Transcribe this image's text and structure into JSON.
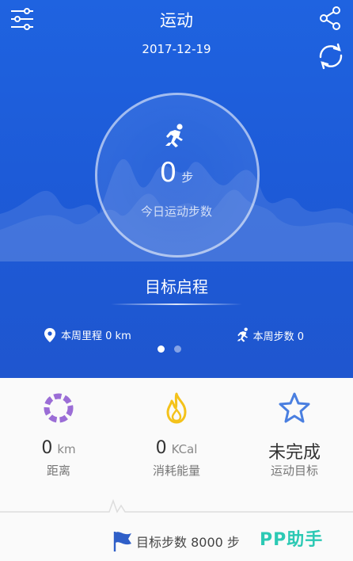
{
  "header": {
    "title": "运动",
    "date": "2017-12-19",
    "menu_icon": "settings-sliders-icon",
    "share_icon": "share-icon",
    "sync_icon": "sync-icon"
  },
  "today": {
    "steps_value": "0",
    "steps_unit": "步",
    "steps_label": "今日运动步数",
    "icon": "running-icon"
  },
  "goal_start_label": "目标启程",
  "weekly": {
    "distance_label": "本周里程 0 km",
    "steps_label": "本周步数 0"
  },
  "pager": {
    "pages": 2,
    "active": 0
  },
  "stats": {
    "distance": {
      "value": "0",
      "unit": "km",
      "label": "距离",
      "icon": "ring-segments-icon",
      "color": "#9b6dd6"
    },
    "energy": {
      "value": "0",
      "unit": "KCal",
      "label": "消耗能量",
      "icon": "flame-icon",
      "color": "#f4c21a"
    },
    "goal": {
      "value": "未完成",
      "label": "运动目标",
      "icon": "star-icon",
      "color": "#4a7fe0"
    }
  },
  "goal_steps_label": "目标步数 8000 步",
  "watermark": "PP助手",
  "colors": {
    "primary": "#1f5fdc",
    "accent": "#2cc9b4"
  }
}
